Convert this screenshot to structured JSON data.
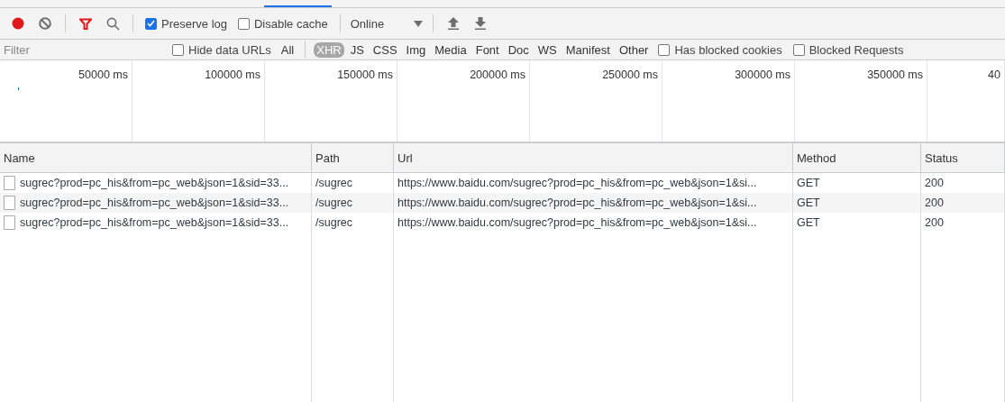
{
  "toolbar": {
    "record": {
      "on": true
    },
    "filter_toggle": {
      "on": true
    },
    "preserve_log": {
      "label": "Preserve log",
      "checked": true
    },
    "disable_cache": {
      "label": "Disable cache",
      "checked": false
    },
    "throttling": {
      "value": "Online"
    }
  },
  "filter_bar": {
    "placeholder": "Filter",
    "hide_data_urls": {
      "label": "Hide data URLs",
      "checked": false
    },
    "types": [
      {
        "label": "All",
        "selected": false
      },
      {
        "label": "XHR",
        "selected": true
      },
      {
        "label": "JS",
        "selected": false
      },
      {
        "label": "CSS",
        "selected": false
      },
      {
        "label": "Img",
        "selected": false
      },
      {
        "label": "Media",
        "selected": false
      },
      {
        "label": "Font",
        "selected": false
      },
      {
        "label": "Doc",
        "selected": false
      },
      {
        "label": "WS",
        "selected": false
      },
      {
        "label": "Manifest",
        "selected": false
      },
      {
        "label": "Other",
        "selected": false
      }
    ],
    "options": [
      {
        "label": "Has blocked cookies",
        "checked": false
      },
      {
        "label": "Blocked Requests",
        "checked": false
      }
    ]
  },
  "timeline": {
    "ticks": [
      "50000 ms",
      "100000 ms",
      "150000 ms",
      "200000 ms",
      "250000 ms",
      "300000 ms",
      "350000 ms",
      "40"
    ]
  },
  "table": {
    "columns": [
      "Name",
      "Path",
      "Url",
      "Method",
      "Status"
    ],
    "rows": [
      {
        "name": "sugrec?prod=pc_his&from=pc_web&json=1&sid=33...",
        "path": "/sugrec",
        "url": "https://www.baidu.com/sugrec?prod=pc_his&from=pc_web&json=1&si...",
        "method": "GET",
        "status": "200"
      },
      {
        "name": "sugrec?prod=pc_his&from=pc_web&json=1&sid=33...",
        "path": "/sugrec",
        "url": "https://www.baidu.com/sugrec?prod=pc_his&from=pc_web&json=1&si...",
        "method": "GET",
        "status": "200"
      },
      {
        "name": "sugrec?prod=pc_his&from=pc_web&json=1&sid=33...",
        "path": "/sugrec",
        "url": "https://www.baidu.com/sugrec?prod=pc_his&from=pc_web&json=1&si...",
        "method": "GET",
        "status": "200"
      }
    ]
  }
}
